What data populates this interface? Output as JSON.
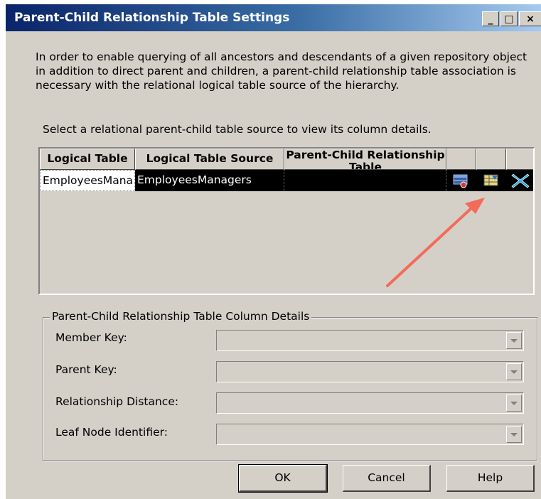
{
  "window": {
    "title": "Parent-Child Relationship Table Settings",
    "min_label": "_",
    "max_label": "□",
    "close_label": "×"
  },
  "intro_text": "In order to enable querying of all ancestors and descendants of a given repository object in addition to direct parent and children, a parent-child relationship table association is necessary with the relational logical table source of the hierarchy.",
  "select_text": "Select a relational parent-child table source to view its column details.",
  "grid": {
    "columns": [
      "Logical Table",
      "Logical Table Source",
      "Parent-Child Relationship Table",
      "",
      "",
      ""
    ],
    "rows": [
      {
        "logical_table": "EmployeesMana",
        "logical_table_source": "EmployeesManagers",
        "parent_child_table": ""
      }
    ],
    "icons": [
      "select-table-icon",
      "edit-table-icon",
      "delete-icon"
    ]
  },
  "details": {
    "legend": "Parent-Child Relationship Table Column Details",
    "member_key_label": "Member Key:",
    "parent_key_label": "Parent Key:",
    "relationship_distance_label": "Relationship Distance:",
    "leaf_node_label": "Leaf Node Identifier:",
    "member_key_value": "",
    "parent_key_value": "",
    "relationship_distance_value": "",
    "leaf_node_value": ""
  },
  "buttons": {
    "ok": "OK",
    "cancel": "Cancel",
    "help": "Help"
  },
  "colors": {
    "dialog_bg": "#d4d0c8",
    "title_start": "#0a246a",
    "title_end": "#a6caf0",
    "selected_row": "#000000",
    "annotation_arrow": "#f26b5b"
  }
}
